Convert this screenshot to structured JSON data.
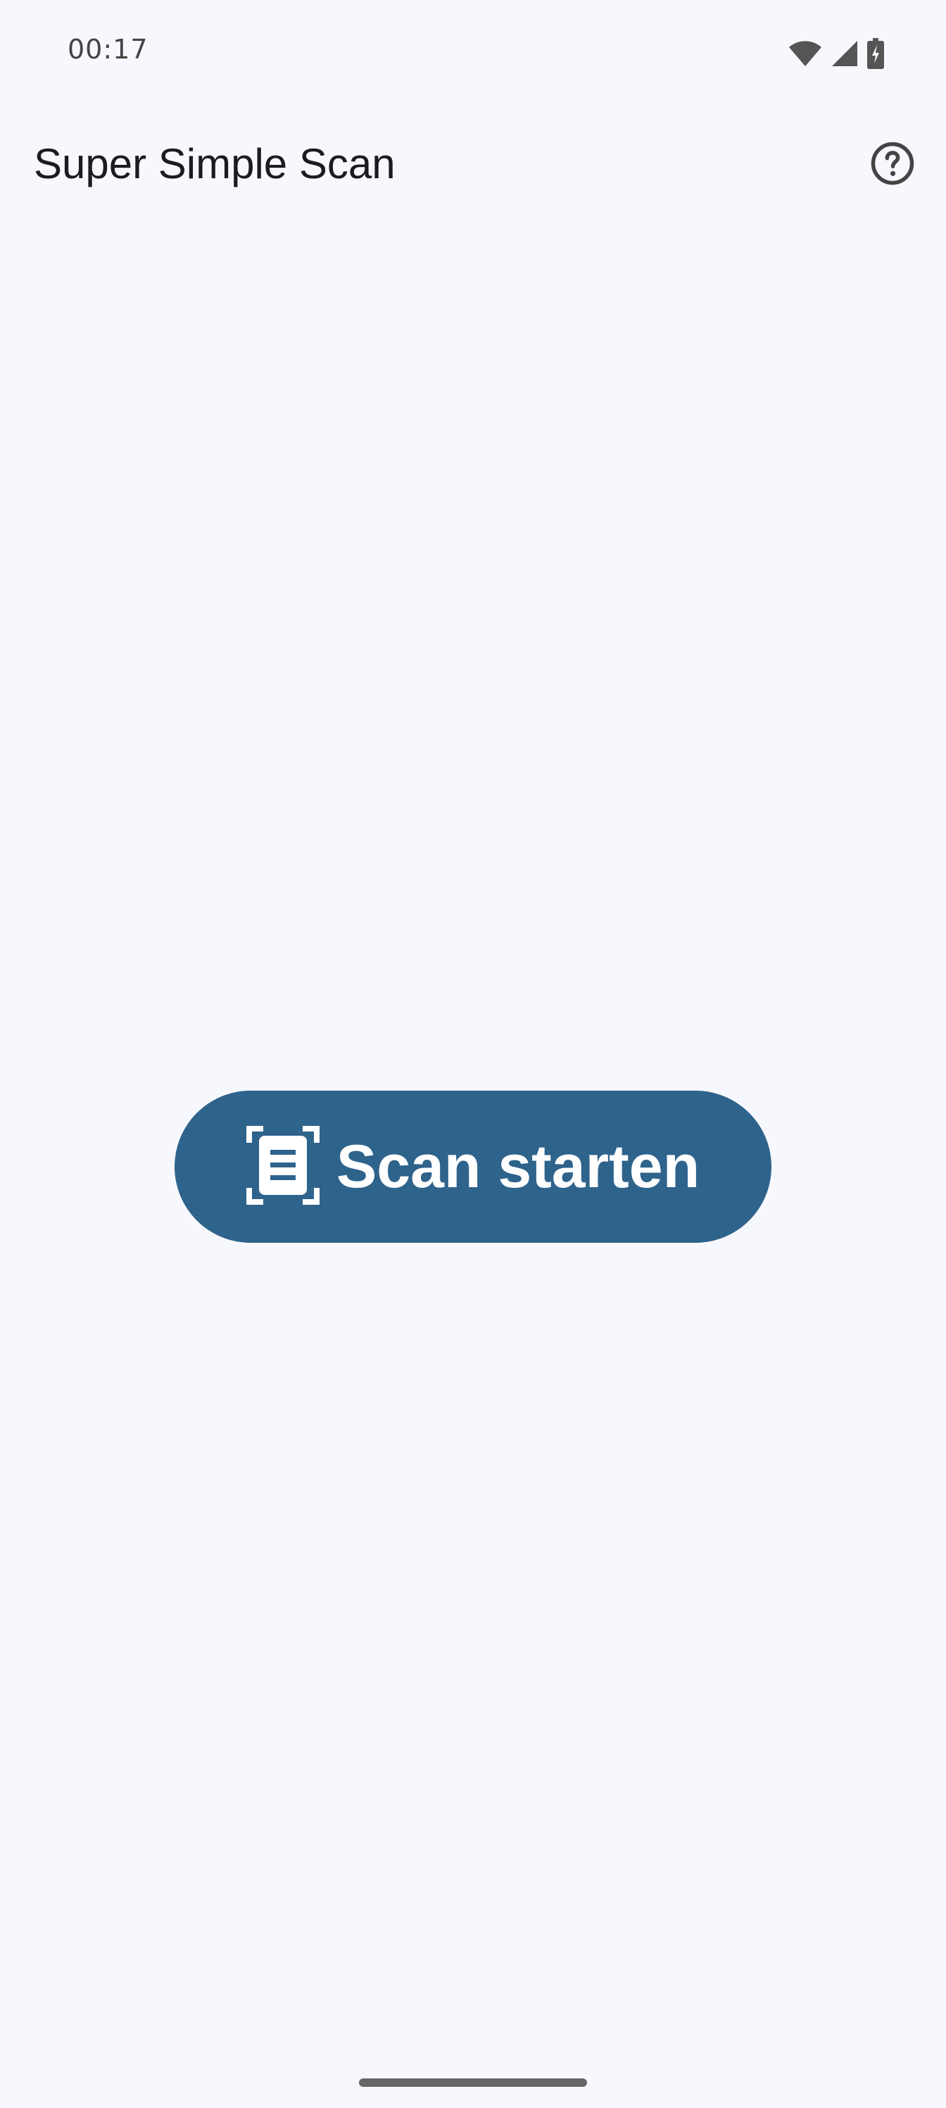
{
  "status_bar": {
    "time": "00:17",
    "icons": [
      "wifi-icon",
      "cellular-signal-icon",
      "battery-charging-icon"
    ]
  },
  "app_bar": {
    "title": "Super Simple Scan",
    "help_icon": "help-circle-icon"
  },
  "main": {
    "scan_button": {
      "label": "Scan starten",
      "icon": "document-scanner-icon"
    }
  },
  "colors": {
    "background": "#f7f8fd",
    "primary": "#2e638c",
    "on_primary": "#ffffff",
    "text": "#1a1c1e"
  }
}
